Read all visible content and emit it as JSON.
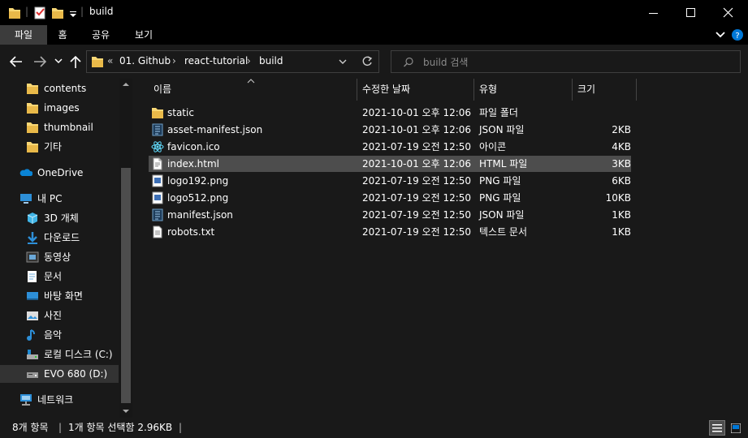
{
  "window": {
    "title": "build"
  },
  "ribbon": {
    "tabs": [
      {
        "label": "파일",
        "active": true
      },
      {
        "label": "홈"
      },
      {
        "label": "공유"
      },
      {
        "label": "보기"
      }
    ]
  },
  "address": {
    "prefix": "«",
    "crumbs": [
      "01. Github",
      "react-tutorial",
      "build"
    ]
  },
  "search": {
    "placeholder": "build 검색"
  },
  "sidebar": {
    "items": [
      {
        "label": "contents",
        "icon": "folder-icon",
        "indent": 1
      },
      {
        "label": "images",
        "icon": "folder-icon",
        "indent": 1
      },
      {
        "label": "thumbnail",
        "icon": "folder-icon",
        "indent": 1
      },
      {
        "label": "기타",
        "icon": "folder-icon",
        "indent": 1
      },
      {
        "label": "OneDrive",
        "icon": "onedrive-icon",
        "indent": 0
      },
      {
        "label": "내 PC",
        "icon": "pc-icon",
        "indent": 0
      },
      {
        "label": "3D 개체",
        "icon": "3d-objects-icon",
        "indent": 1
      },
      {
        "label": "다운로드",
        "icon": "download-icon",
        "indent": 1
      },
      {
        "label": "동영상",
        "icon": "video-icon",
        "indent": 1
      },
      {
        "label": "문서",
        "icon": "document-icon",
        "indent": 1
      },
      {
        "label": "바탕 화면",
        "icon": "desktop-icon",
        "indent": 1
      },
      {
        "label": "사진",
        "icon": "pictures-icon",
        "indent": 1
      },
      {
        "label": "음악",
        "icon": "music-icon",
        "indent": 1
      },
      {
        "label": "로컬 디스크 (C:)",
        "icon": "local-disk-icon",
        "indent": 1
      },
      {
        "label": "EVO 680 (D:)",
        "icon": "drive-icon",
        "indent": 1,
        "selected": true
      },
      {
        "label": "네트워크",
        "icon": "network-icon",
        "indent": 0
      }
    ]
  },
  "columns": {
    "name": "이름",
    "date": "수정한 날짜",
    "type": "유형",
    "size": "크기"
  },
  "files": [
    {
      "name": "static",
      "date": "2021-10-01 오후 12:06",
      "type": "파일 폴더",
      "size": "",
      "icon": "folder-icon"
    },
    {
      "name": "asset-manifest.json",
      "date": "2021-10-01 오후 12:06",
      "type": "JSON 파일",
      "size": "2KB",
      "icon": "json-file-icon"
    },
    {
      "name": "favicon.ico",
      "date": "2021-07-19 오전 12:50",
      "type": "아이콘",
      "size": "4KB",
      "icon": "react-icon"
    },
    {
      "name": "index.html",
      "date": "2021-10-01 오후 12:06",
      "type": "HTML 파일",
      "size": "3KB",
      "icon": "html-file-icon",
      "selected": true
    },
    {
      "name": "logo192.png",
      "date": "2021-07-19 오전 12:50",
      "type": "PNG 파일",
      "size": "6KB",
      "icon": "image-file-icon"
    },
    {
      "name": "logo512.png",
      "date": "2021-07-19 오전 12:50",
      "type": "PNG 파일",
      "size": "10KB",
      "icon": "image-file-icon"
    },
    {
      "name": "manifest.json",
      "date": "2021-07-19 오전 12:50",
      "type": "JSON 파일",
      "size": "1KB",
      "icon": "json-file-icon"
    },
    {
      "name": "robots.txt",
      "date": "2021-07-19 오전 12:50",
      "type": "텍스트 문서",
      "size": "1KB",
      "icon": "text-file-icon"
    }
  ],
  "status": {
    "count": "8개 항목",
    "selection": "1개 항목 선택함 2.96KB"
  },
  "colors": {
    "folder": "#f8d775",
    "accent": "#0078d7",
    "selection": "#4d4d4d"
  }
}
